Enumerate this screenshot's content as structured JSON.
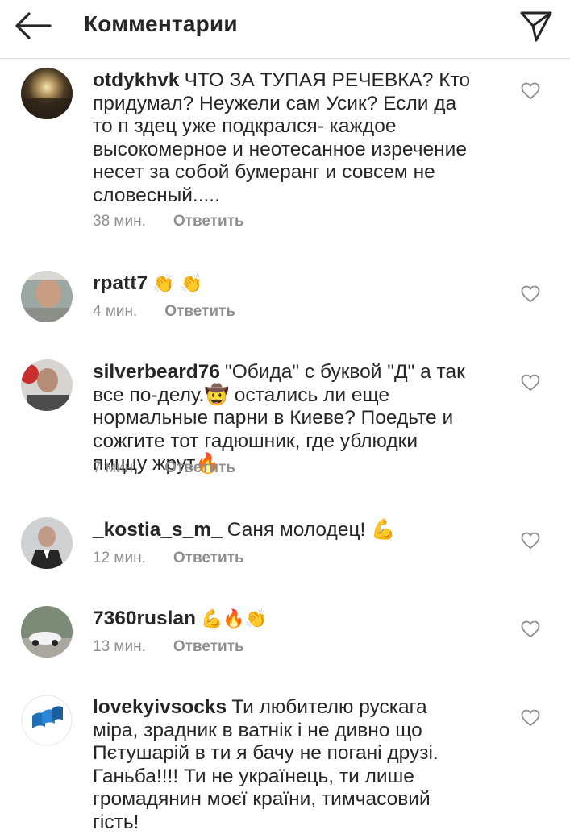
{
  "header": {
    "title": "Комментарии",
    "back_icon": "arrow-left-icon",
    "send_icon": "paper-plane-icon"
  },
  "comments": [
    {
      "username": "otdykhvk",
      "text": "ЧТО ЗА ТУПАЯ РЕЧЕВКА? Кто придумал? Неужели сам Усик? Если да то п  здец уже подкрался- каждое высокомерное и неотесанное изречение несет за собой бумеранг и совсем не словесный.....",
      "time": "38 мин.",
      "reply": "Ответить"
    },
    {
      "username": "rpatt7",
      "text": "👏 👏",
      "time": "4 мин.",
      "reply": "Ответить"
    },
    {
      "username": "silverbeard76",
      "text": "\"Обида\" с буквой \"Д\" а так все по-делу.🤠 остались ли еще нормальные парни в Киеве? Поедьте и сожгите тот гадюшник, где ублюдки пиццу жрут🔥",
      "time": "7 мин.",
      "reply": "Ответить"
    },
    {
      "username": "_kostia_s_m_",
      "text": "Саня молодец! 💪",
      "time": "12 мин.",
      "reply": "Ответить"
    },
    {
      "username": "7360ruslan",
      "text": "💪🔥👏",
      "time": "13 мин.",
      "reply": "Ответить"
    },
    {
      "username": "lovekyivsocks",
      "text": "Ти любителю рускага міра, зрадник в ватнік і не дивно що Пєтушарій в ти я бачу не погані друзі. Ганьба!!!! Ти не українець, ти лише громадянин моєї країни, тимчасовий гість!",
      "time": "",
      "reply": ""
    }
  ],
  "colors": {
    "text": "#262626",
    "secondary": "#8e8e8e",
    "divider": "#dbdbdb"
  }
}
